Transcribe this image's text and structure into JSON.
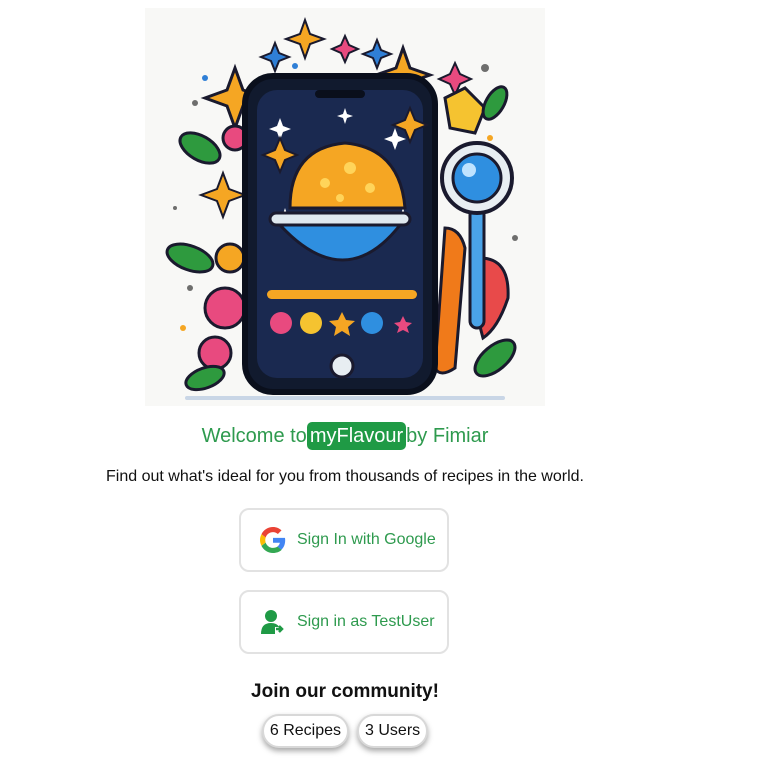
{
  "welcome": {
    "prefix": "Welcome to",
    "brand": "myFlavour",
    "suffix": "by Fimiar"
  },
  "tagline": "Find out what's ideal for you from thousands of recipes in the world.",
  "buttons": {
    "google": {
      "label": "Sign In with Google",
      "icon": "google-icon"
    },
    "testuser": {
      "label": "Sign in as TestUser",
      "icon": "user-login-icon"
    }
  },
  "community": {
    "title": "Join our community!",
    "recipes": "6 Recipes",
    "users": "3 Users"
  },
  "colors": {
    "accent": "#1f9a45",
    "text_green": "#2e9a4e"
  }
}
